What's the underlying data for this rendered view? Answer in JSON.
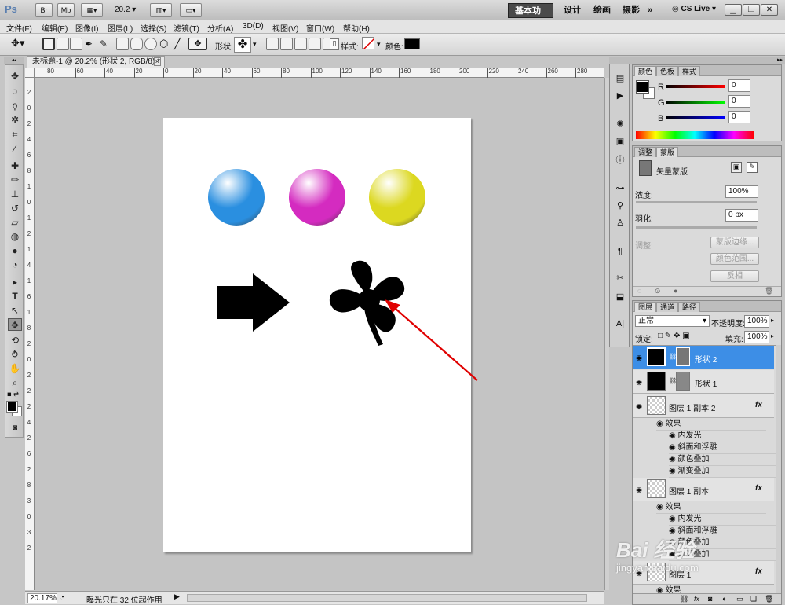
{
  "titlebar": {
    "logo": "Ps",
    "btn_br": "Br",
    "btn_mb": "Mb",
    "zoom": "20.2",
    "workspaces": [
      "基本功能",
      "设计",
      "绘画",
      "摄影"
    ],
    "more": "»",
    "cslive": "CS Live"
  },
  "menu": [
    "文件(F)",
    "编辑(E)",
    "图像(I)",
    "图层(L)",
    "选择(S)",
    "滤镜(T)",
    "分析(A)",
    "3D(D)",
    "视图(V)",
    "窗口(W)",
    "帮助(H)"
  ],
  "options": {
    "shape_label": "形状:",
    "style_label": "样式:",
    "color_label": "颜色:",
    "color_value": "#000000"
  },
  "document": {
    "tab_title": "未标题-1 @ 20.2% (形状 2, RGB/8) *",
    "ruler_top": [
      "80",
      "60",
      "40",
      "20",
      "0",
      "20",
      "40",
      "60",
      "80",
      "100",
      "120",
      "140",
      "160",
      "180",
      "200",
      "220",
      "240",
      "260",
      "280"
    ],
    "ruler_left": [
      "2",
      "0",
      "2",
      "4",
      "6",
      "8",
      "1",
      "0",
      "1",
      "2",
      "1",
      "4",
      "1",
      "6",
      "1",
      "8",
      "2",
      "0",
      "2",
      "2",
      "2",
      "4",
      "2",
      "6",
      "2",
      "8",
      "3",
      "0",
      "3",
      "2"
    ],
    "balls": [
      {
        "name": "blue",
        "color": "#2a8fe0"
      },
      {
        "name": "magenta",
        "color": "#d42bc0"
      },
      {
        "name": "yellow",
        "color": "#dcd820"
      }
    ]
  },
  "status": {
    "zoom": "20.17%",
    "info": "曝光只在 32 位起作用"
  },
  "color_panel": {
    "tabs": [
      "颜色",
      "色板",
      "样式"
    ],
    "channels": [
      {
        "label": "R",
        "value": "0",
        "color": "#d00000"
      },
      {
        "label": "G",
        "value": "0",
        "color": "#00b000"
      },
      {
        "label": "B",
        "value": "0",
        "color": "#0000c0"
      }
    ]
  },
  "masks_panel": {
    "tabs": [
      "调整",
      "蒙版"
    ],
    "title": "矢量蒙版",
    "density_label": "浓度:",
    "density_value": "100%",
    "feather_label": "羽化:",
    "feather_value": "0 px",
    "adjust_label": "调整:",
    "btn_edge": "蒙版边缘...",
    "btn_range": "颜色范围...",
    "btn_invert": "反相"
  },
  "layers_panel": {
    "tabs": [
      "图层",
      "通道",
      "路径"
    ],
    "blend_mode": "正常",
    "opacity_label": "不透明度:",
    "opacity_value": "100%",
    "lock_label": "锁定:",
    "fill_label": "填充:",
    "fill_value": "100%",
    "layers": [
      {
        "name": "形状 2",
        "selected": true
      },
      {
        "name": "形状 1",
        "selected": false
      },
      {
        "name": "图层 1 副本 2",
        "fx": "fx",
        "effects_label": "效果",
        "effects": [
          "内发光",
          "斜面和浮雕",
          "颜色叠加",
          "渐变叠加"
        ]
      },
      {
        "name": "图层 1 副本",
        "fx": "fx",
        "effects_label": "效果",
        "effects": [
          "内发光",
          "斜面和浮雕",
          "颜色叠加",
          "渐变叠加"
        ]
      },
      {
        "name": "图层 1",
        "fx": "fx",
        "effects_label": "效果"
      }
    ]
  },
  "watermark": {
    "line1": "Bai 经验",
    "line2": "jingyan.baidu.com"
  }
}
